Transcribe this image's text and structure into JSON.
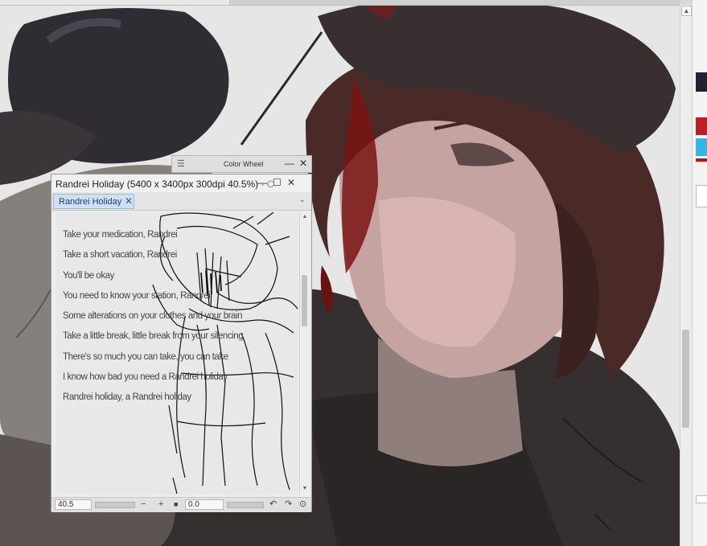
{
  "colorwheel_panel": {
    "title": "Color Wheel",
    "grip_icon": "hamburger-icon",
    "minimize_glyph": "—",
    "close_glyph": "✕"
  },
  "document_window": {
    "title": "Randrei Holiday (5400 x 3400px 300dpi 40.5%)",
    "title_trailing": "- C",
    "minimize_glyph": "—",
    "maximize_glyph": "☐",
    "close_glyph": "✕",
    "tab": {
      "label": "Randrei Holiday",
      "close_glyph": "✕"
    },
    "tab_menu_glyph": "⌄",
    "lyrics": [
      "Take your medication, Randrei",
      "Take a short vacation, Randrei",
      "You'll be okay",
      "You need to know your station, Randrei",
      "Some alterations on your clothes and your brain",
      "Take a little break, little break from your silencing",
      "There's so much you can take, you can take",
      "I know how bad you need a Randrei holiday",
      "Randrei holiday, a Randrei holiday"
    ],
    "status": {
      "zoom": "40.5",
      "zoom_out_glyph": "−",
      "zoom_in_glyph": "+",
      "stop_glyph": "■",
      "rotation": "0.0",
      "rotate_left_glyph": "↶",
      "rotate_right_glyph": "↷",
      "reset_glyph": "⊙"
    }
  },
  "colors": {
    "hair": "#4a2a26",
    "skin": "#d5b0ae",
    "cap": "#3a2f30",
    "blood": "#7a1414",
    "jacket": "#2f2b2a",
    "background": "#e6e6e6"
  }
}
